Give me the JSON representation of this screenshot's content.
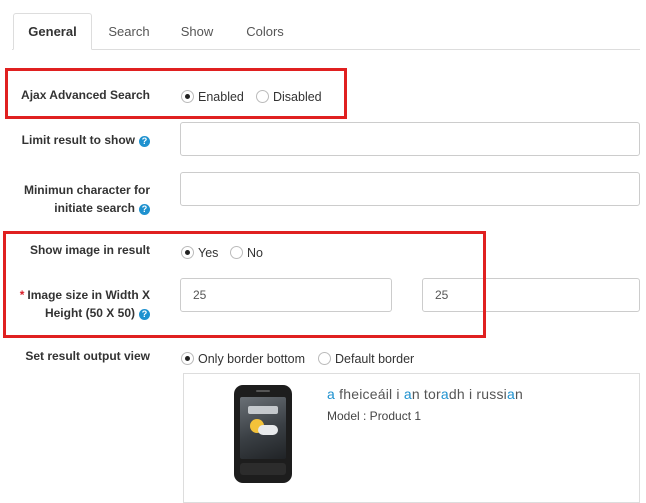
{
  "tabs": [
    {
      "label": "General",
      "active": true
    },
    {
      "label": "Search",
      "active": false
    },
    {
      "label": "Show",
      "active": false
    },
    {
      "label": "Colors",
      "active": false
    }
  ],
  "fields": {
    "ajax": {
      "label": "Ajax Advanced Search",
      "options": [
        "Enabled",
        "Disabled"
      ],
      "selected": "Enabled"
    },
    "limit": {
      "label": "Limit result to show",
      "value": ""
    },
    "min_char": {
      "label_line1": "Minimun character for",
      "label_line2": "initiate search",
      "value": ""
    },
    "show_image": {
      "label": "Show image in result",
      "options": [
        "Yes",
        "No"
      ],
      "selected": "Yes"
    },
    "image_size": {
      "required_mark": "*",
      "label_line1": "Image size in Width X",
      "label_line2": "Height (50 X 50)",
      "width": "25",
      "height": "25"
    },
    "output_view": {
      "label": "Set result output view",
      "options": [
        "Only border bottom",
        "Default border"
      ],
      "selected": "Only border bottom"
    }
  },
  "help_icon": "?",
  "preview": {
    "product_name": "a fheiceáil i an toradh i russian",
    "product_name_highlight_char": "a",
    "model_line": "Model : Product 1",
    "image": "phone-icon"
  },
  "colors": {
    "highlight_box": "#e02020",
    "help_icon": "#1e91cf",
    "required": "#d8202b",
    "match_highlight": "#1e91cf"
  }
}
